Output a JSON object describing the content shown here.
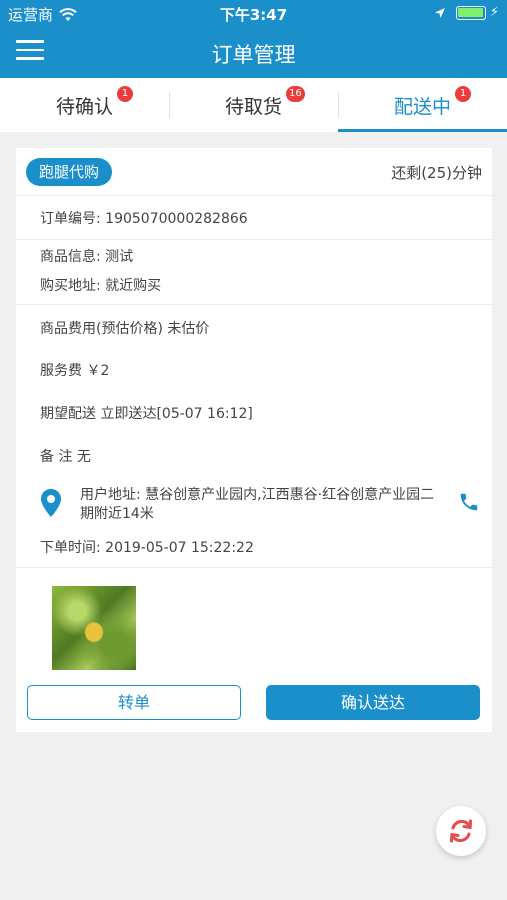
{
  "status_bar": {
    "carrier": "运营商",
    "time": "下午3:47"
  },
  "header": {
    "title": "订单管理",
    "menu_icon": "hamburger-menu-icon"
  },
  "tabs": [
    {
      "label": "待确认",
      "badge": "1",
      "active": false
    },
    {
      "label": "待取货",
      "badge": "16",
      "active": false
    },
    {
      "label": "配送中",
      "badge": "1",
      "active": true
    }
  ],
  "order": {
    "tag": "跑腿代购",
    "remaining": "还剩(25)分钟",
    "order_number": "订单编号: 1905070000282866",
    "goods_info": "商品信息:  测试",
    "purchase_address": "购买地址:  就近购买",
    "goods_cost": "商品费用(预估价格)   未估价",
    "service_fee": "服务费    ￥2",
    "expected_delivery": "期望配送    立即送达[05-07 16:12]",
    "note": "备  注    无",
    "user_address": "用户地址:  慧谷创意产业园内,江西惠谷·红谷创意产业园二期附近14米",
    "order_time": "下单时间: 2019-05-07 15:22:22"
  },
  "actions": {
    "transfer": "转单",
    "confirm_delivery": "确认送达"
  },
  "colors": {
    "brand": "#1a8fc9",
    "badge": "#ec3b3b",
    "refresh": "#e84b4b"
  }
}
